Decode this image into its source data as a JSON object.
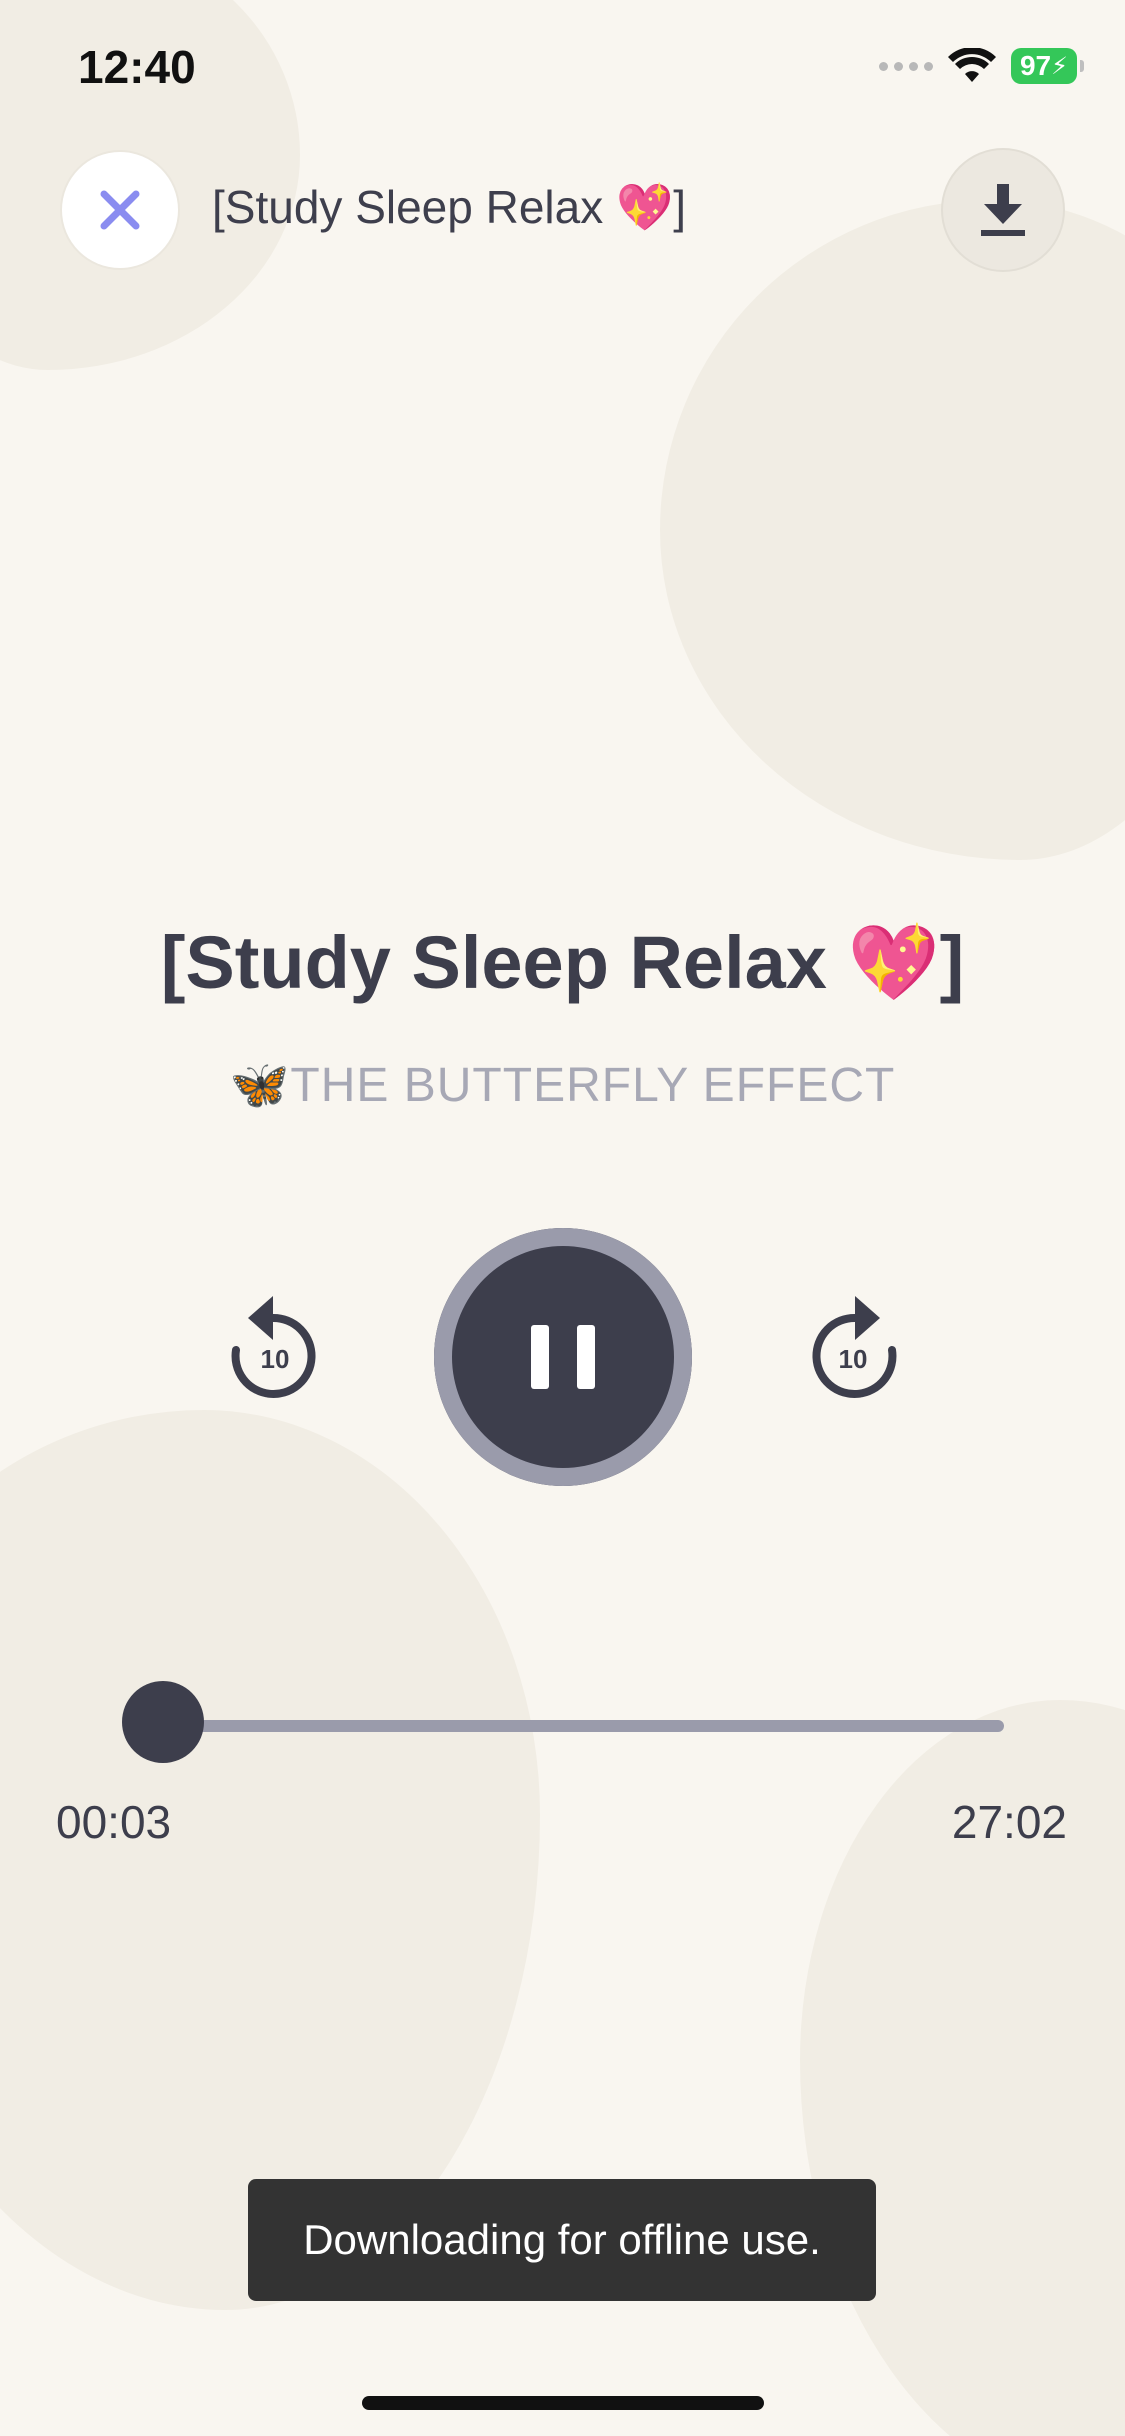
{
  "status_bar": {
    "time": "12:40",
    "battery": "97"
  },
  "header": {
    "title": "[Study Sleep Relax 💖]"
  },
  "track": {
    "title": "[Study Sleep Relax 💖]",
    "artist": "🦋THE BUTTERFLY EFFECT"
  },
  "controls": {
    "skip_back_label": "10",
    "skip_forward_label": "10"
  },
  "progress": {
    "elapsed": "00:03",
    "total": "27:02",
    "fraction": 0.002
  },
  "toast": {
    "message": "Downloading for offline use."
  },
  "colors": {
    "background": "#f9f6f0",
    "primary": "#3d3e4c",
    "muted": "#9a9bab",
    "close_accent": "#8a8cf0",
    "battery": "#34c759"
  },
  "icons": {
    "close": "close-icon",
    "download": "download-icon",
    "skip_back": "rewind-10-icon",
    "skip_forward": "forward-10-icon",
    "pause": "pause-icon",
    "wifi": "wifi-icon"
  }
}
